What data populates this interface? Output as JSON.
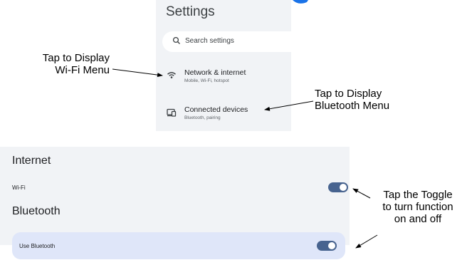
{
  "settings": {
    "title": "Settings",
    "search_placeholder": "Search settings",
    "items": [
      {
        "label": "Network & internet",
        "sub": "Mobile, Wi-Fi, hotspot",
        "icon": "wifi-icon"
      },
      {
        "label": "Connected devices",
        "sub": "Bluetooth, pairing",
        "icon": "devices-icon"
      }
    ]
  },
  "annotations": {
    "wifi": "Tap to Display\nWi-Fi Menu",
    "bluetooth": "Tap to Display\nBluetooth Menu",
    "toggle": "Tap the Toggle\nto turn function\non and off"
  },
  "internet": {
    "title": "Internet",
    "wifi_label": "Wi-Fi",
    "wifi_on": true
  },
  "bluetooth": {
    "title": "Bluetooth",
    "use_label": "Use Bluetooth",
    "bt_on": true
  },
  "colors": {
    "panel_bg": "#f1f3f6",
    "toggle_on": "#47638f",
    "highlight_row": "#dfe6f9",
    "title_accent": "#1a73e8"
  }
}
